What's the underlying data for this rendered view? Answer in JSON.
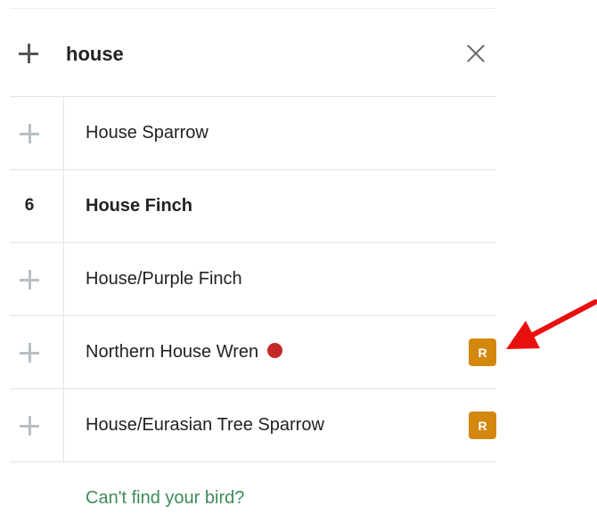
{
  "search": {
    "value": "house"
  },
  "results": [
    {
      "name": "House Sparrow",
      "count": "",
      "bold": false,
      "has_dot": false,
      "badge": ""
    },
    {
      "name": "House Finch",
      "count": "6",
      "bold": true,
      "has_dot": false,
      "badge": ""
    },
    {
      "name": "House/Purple Finch",
      "count": "",
      "bold": false,
      "has_dot": false,
      "badge": ""
    },
    {
      "name": "Northern House Wren",
      "count": "",
      "bold": false,
      "has_dot": true,
      "badge": "R"
    },
    {
      "name": "House/Eurasian Tree Sparrow",
      "count": "",
      "bold": false,
      "has_dot": false,
      "badge": "R"
    }
  ],
  "footer": {
    "help_link": "Can't find your bird?"
  },
  "colors": {
    "badge": "#d4870e",
    "dot": "#c62828",
    "link": "#3e8a57",
    "arrow": "#e8100f"
  },
  "icons": {
    "add": "plus-icon",
    "clear": "close-icon",
    "rare_dot": "red-dot-icon"
  }
}
